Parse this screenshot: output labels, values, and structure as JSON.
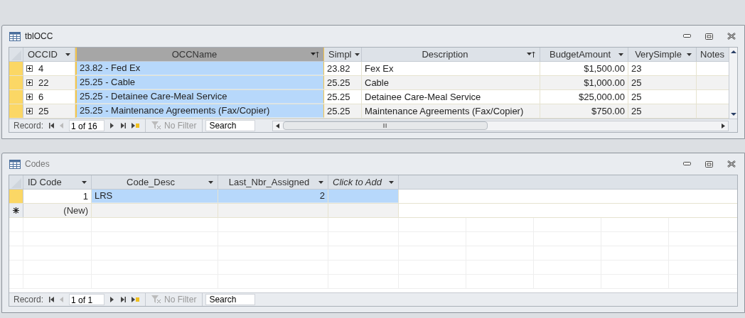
{
  "windows": [
    {
      "title": "tblOCC",
      "horizontal_scrollbar": true,
      "vertical_scrollbar": true,
      "columns": [
        {
          "label": "OCCID",
          "kind": "text",
          "sorted": false,
          "selected": false
        },
        {
          "label": "OCCName",
          "kind": "text",
          "sorted": true,
          "selected": true
        },
        {
          "label": "Simpl",
          "kind": "text",
          "sorted": false,
          "selected": false
        },
        {
          "label": "Description",
          "kind": "text",
          "sorted": true,
          "selected": false
        },
        {
          "label": "BudgetAmount",
          "kind": "number",
          "sorted": false,
          "selected": false
        },
        {
          "label": "VerySimple",
          "kind": "text",
          "sorted": false,
          "selected": false
        },
        {
          "label": "Notes",
          "kind": "cut",
          "selected": false
        }
      ],
      "rows": [
        {
          "kind": "record",
          "expanded": false,
          "selected": false,
          "cells": [
            "4",
            "23.82 - Fed Ex",
            "23.82",
            "Fex Ex",
            "$1,500.00",
            "23",
            ""
          ]
        },
        {
          "kind": "record",
          "expanded": false,
          "selected": false,
          "cells": [
            "22",
            "25.25 - Cable",
            "25.25",
            "Cable",
            "$1,000.00",
            "25",
            ""
          ]
        },
        {
          "kind": "record",
          "expanded": false,
          "selected": false,
          "cells": [
            "6",
            "25.25 - Detainee Care-Meal Service",
            "25.25",
            "Detainee Care-Meal Service",
            "$25,000.00",
            "25",
            ""
          ]
        },
        {
          "kind": "record",
          "expanded": false,
          "selected": false,
          "cells": [
            "25",
            "25.25 - Maintenance Agreements (Fax/Copier)",
            "25.25",
            "Maintenance Agreements (Fax/Copier)",
            "$750.00",
            "25",
            ""
          ]
        }
      ],
      "navigation": {
        "label": "Record:",
        "position": "1 of 16",
        "filter": "No Filter",
        "search_placeholder": "Search"
      }
    },
    {
      "title": "Codes",
      "horizontal_scrollbar": false,
      "vertical_scrollbar": false,
      "columns": [
        {
          "label": "ID Code",
          "kind": "number",
          "sorted": false,
          "selected": false
        },
        {
          "label": "Code_Desc",
          "kind": "text",
          "sorted": false,
          "selected": false
        },
        {
          "label": "Last_Nbr_Assigned",
          "kind": "number",
          "sorted": false,
          "selected": false
        },
        {
          "label": "Click to Add",
          "kind": "add",
          "sorted": false,
          "selected": false
        }
      ],
      "rows": [
        {
          "kind": "record",
          "selected": true,
          "cells": [
            "1",
            "LRS",
            "2",
            ""
          ]
        },
        {
          "kind": "new",
          "selected": false,
          "cells": [
            "(New)",
            "",
            "",
            ""
          ]
        }
      ],
      "navigation": {
        "label": "Record:",
        "position": "1 of 1",
        "filter": "No Filter",
        "search_placeholder": "Search"
      }
    }
  ]
}
